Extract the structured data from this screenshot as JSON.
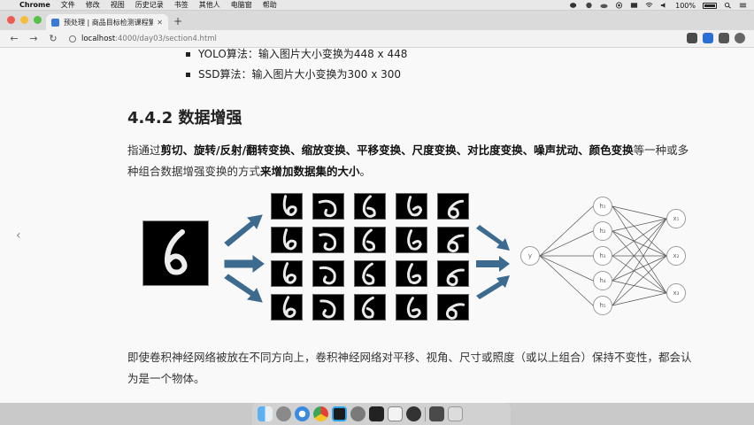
{
  "menubar": {
    "app_name": "Chrome",
    "items": [
      "文件",
      "修改",
      "视图",
      "历史记录",
      "书签",
      "其他人",
      "电脑窗",
      "帮助"
    ],
    "battery": "100%"
  },
  "tab": {
    "title": "预处理 | 商品目标检测课程繁实"
  },
  "address": {
    "host": "localhost",
    "path": ":4000/day03/section4.html"
  },
  "content": {
    "bullets": [
      "YOLO算法：输入图片大小变换为448 x 448",
      "SSD算法：输入图片大小变换为300 x 300"
    ],
    "heading": "4.4.2 数据增强",
    "para1_normal_1": "指通过",
    "para1_bold_1": "剪切、旋转/反射/翻转变换、缩放变换、平移变换、尺度变换、对比度变换、噪声扰动、颜色变换",
    "para1_normal_2": "等一种或多种组合数据增强变换的方式",
    "para1_bold_2": "来增加数据集的大小",
    "para1_normal_3": "。",
    "para2": "即使卷积神经网络被放在不同方向上，卷积神经网络对平移、视角、尺寸或照度（或以上组合）保持不变性，都会认为是一个物体。"
  },
  "figure": {
    "input_node": "y",
    "hidden_nodes": [
      "h₁",
      "h₂",
      "h₃",
      "h₄",
      "h₅"
    ],
    "output_nodes": [
      "x₁",
      "x₂",
      "x₃"
    ]
  },
  "colors": {
    "arrow": "#3d6a8f",
    "traffic_close": "#ee5b55",
    "traffic_min": "#f6bd3a",
    "traffic_max": "#56c144"
  },
  "dock": {
    "icons": [
      "finder-icon",
      "launchpad-icon",
      "safari-icon",
      "chrome-icon",
      "pycharm-icon",
      "system-preferences-icon",
      "terminal-icon",
      "typora-icon",
      "obs-icon",
      "screenshot-icon",
      "trash-icon"
    ]
  }
}
